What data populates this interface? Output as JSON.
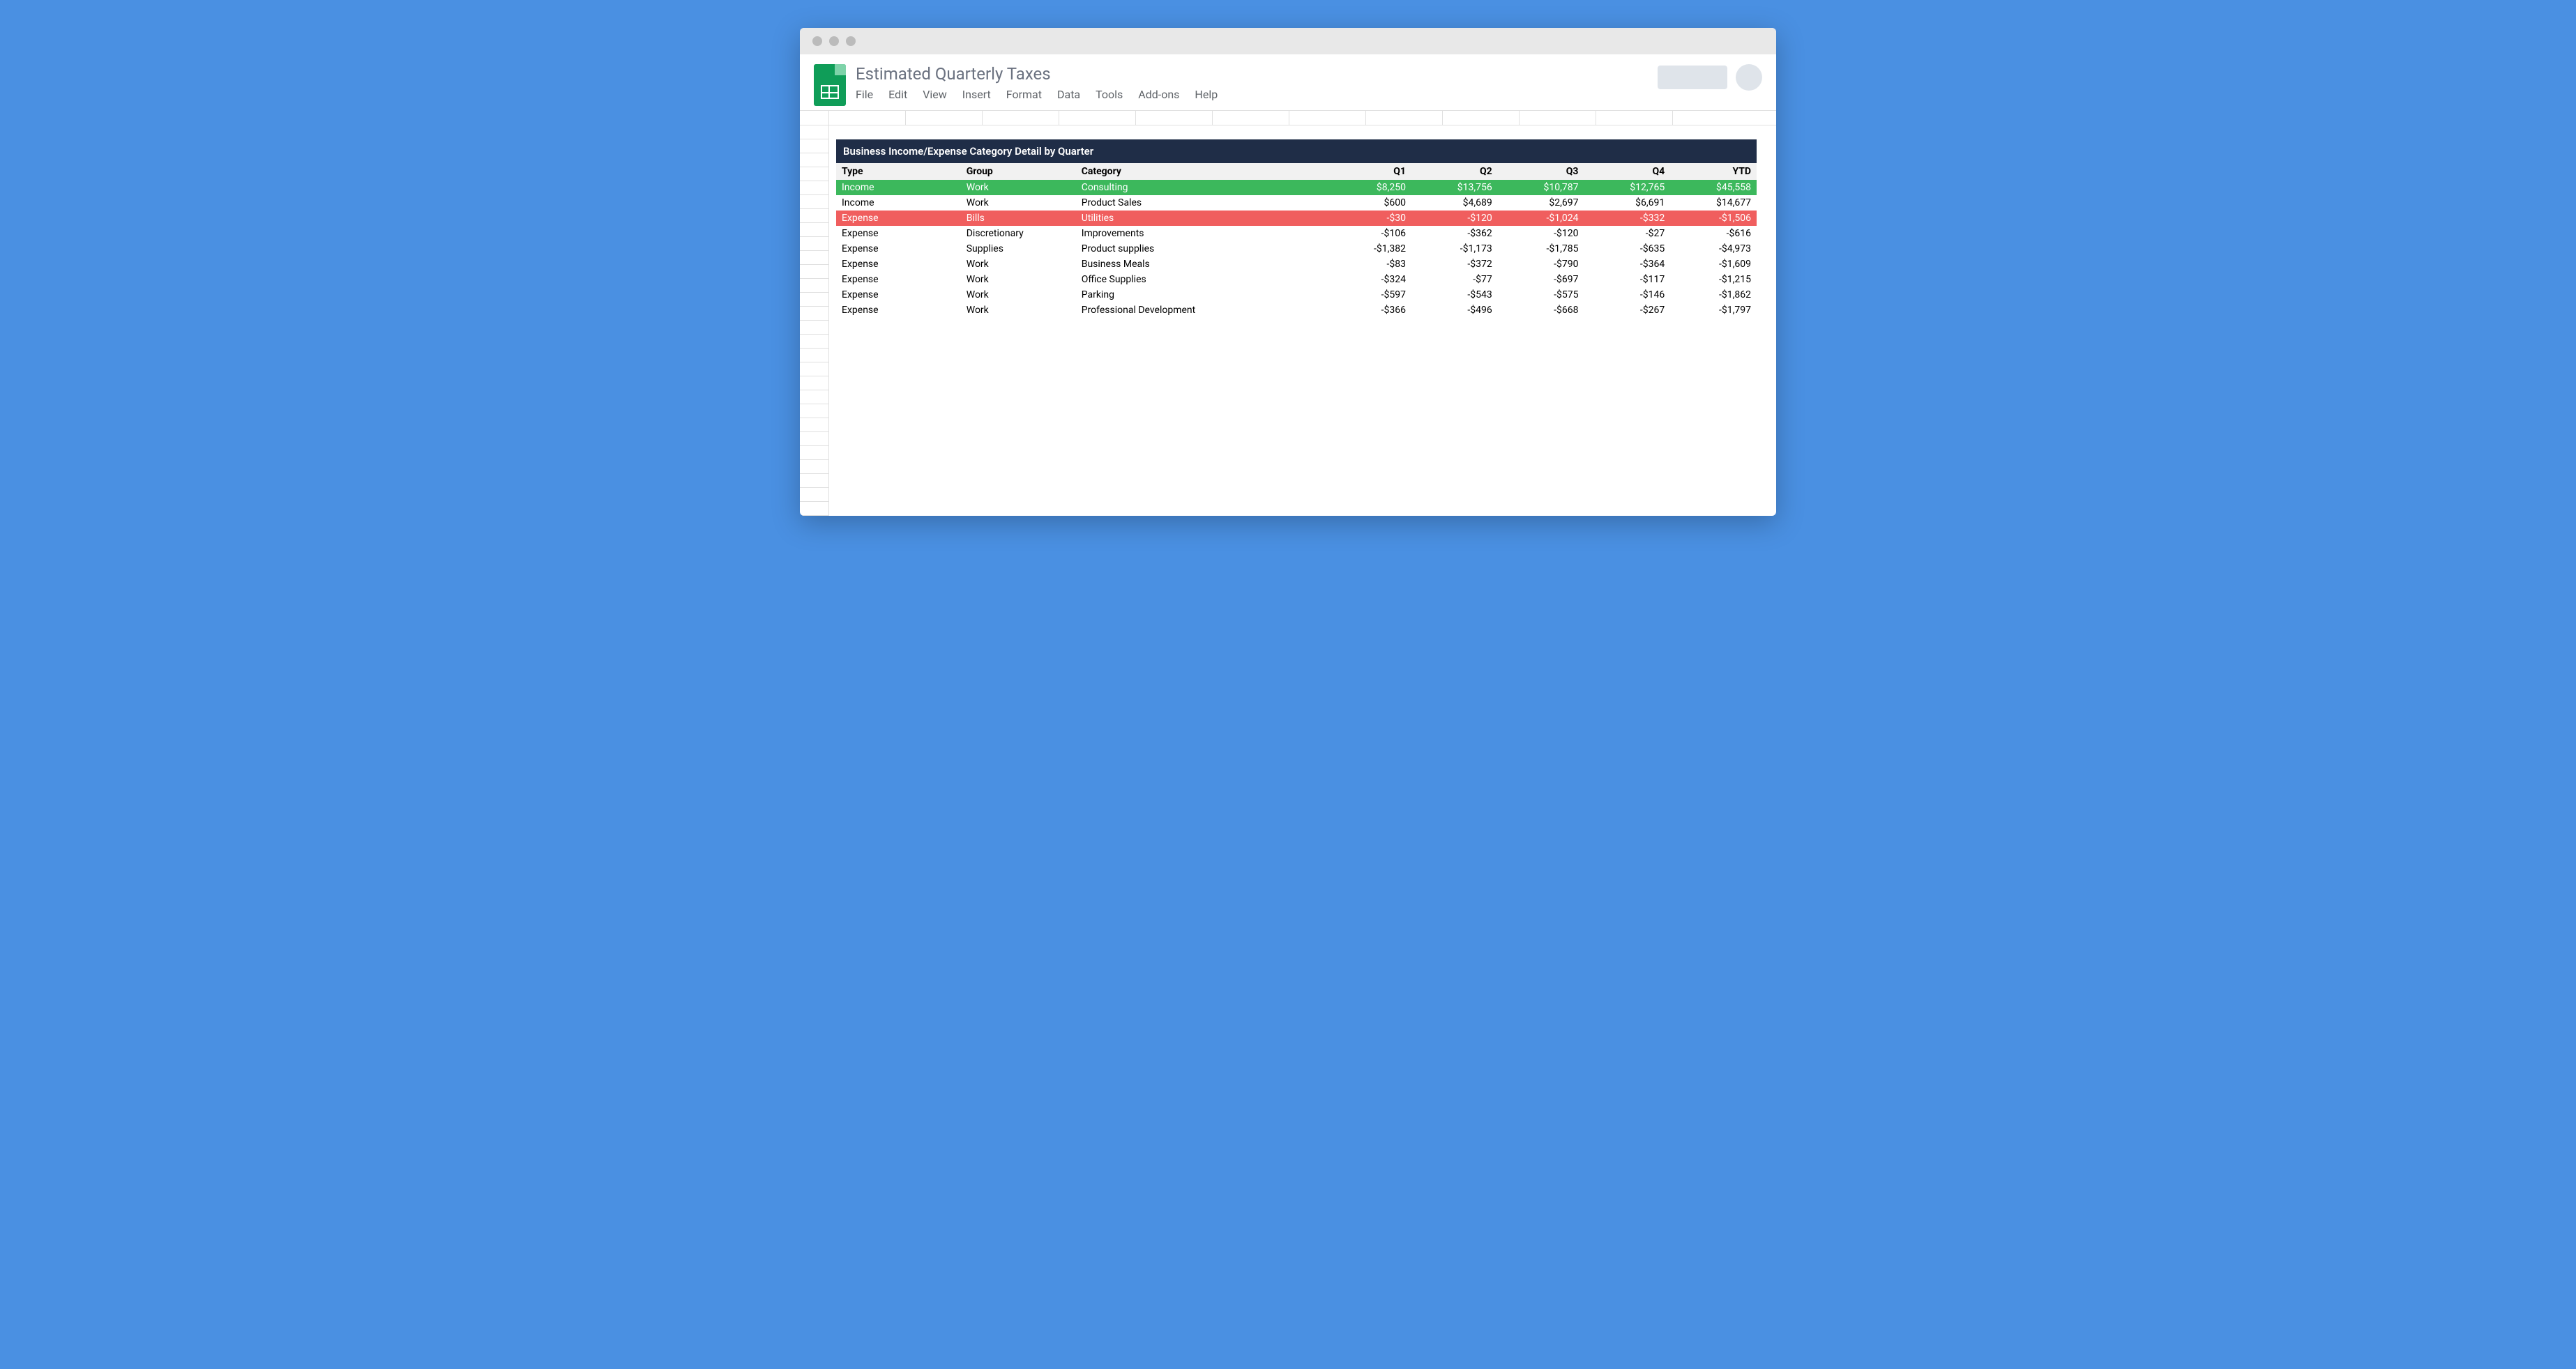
{
  "doc": {
    "title": "Estimated Quarterly Taxes"
  },
  "menu": {
    "file": "File",
    "edit": "Edit",
    "view": "View",
    "insert": "Insert",
    "format": "Format",
    "data": "Data",
    "tools": "Tools",
    "addons": "Add-ons",
    "help": "Help"
  },
  "section": {
    "title": "Business Income/Expense Category Detail by Quarter"
  },
  "columns": {
    "type": "Type",
    "group": "Group",
    "category": "Category",
    "q1": "Q1",
    "q2": "Q2",
    "q3": "Q3",
    "q4": "Q4",
    "ytd": "YTD"
  },
  "rows": [
    {
      "type": "Income",
      "group": "Work",
      "category": "Consulting",
      "q1": "$8,250",
      "q2": "$13,756",
      "q3": "$10,787",
      "q4": "$12,765",
      "ytd": "$45,558",
      "hl": "green"
    },
    {
      "type": "Income",
      "group": "Work",
      "category": "Product Sales",
      "q1": "$600",
      "q2": "$4,689",
      "q3": "$2,697",
      "q4": "$6,691",
      "ytd": "$14,677",
      "hl": ""
    },
    {
      "type": "Expense",
      "group": "Bills",
      "category": "Utilities",
      "q1": "-$30",
      "q2": "-$120",
      "q3": "-$1,024",
      "q4": "-$332",
      "ytd": "-$1,506",
      "hl": "red"
    },
    {
      "type": "Expense",
      "group": "Discretionary",
      "category": "Improvements",
      "q1": "-$106",
      "q2": "-$362",
      "q3": "-$120",
      "q4": "-$27",
      "ytd": "-$616",
      "hl": ""
    },
    {
      "type": "Expense",
      "group": "Supplies",
      "category": "Product supplies",
      "q1": "-$1,382",
      "q2": "-$1,173",
      "q3": "-$1,785",
      "q4": "-$635",
      "ytd": "-$4,973",
      "hl": ""
    },
    {
      "type": "Expense",
      "group": "Work",
      "category": "Business Meals",
      "q1": "-$83",
      "q2": "-$372",
      "q3": "-$790",
      "q4": "-$364",
      "ytd": "-$1,609",
      "hl": ""
    },
    {
      "type": "Expense",
      "group": "Work",
      "category": "Office Supplies",
      "q1": "-$324",
      "q2": "-$77",
      "q3": "-$697",
      "q4": "-$117",
      "ytd": "-$1,215",
      "hl": ""
    },
    {
      "type": "Expense",
      "group": "Work",
      "category": "Parking",
      "q1": "-$597",
      "q2": "-$543",
      "q3": "-$575",
      "q4": "-$146",
      "ytd": "-$1,862",
      "hl": ""
    },
    {
      "type": "Expense",
      "group": "Work",
      "category": "Professional Development",
      "q1": "-$366",
      "q2": "-$496",
      "q3": "-$668",
      "q4": "-$267",
      "ytd": "-$1,797",
      "hl": ""
    }
  ]
}
